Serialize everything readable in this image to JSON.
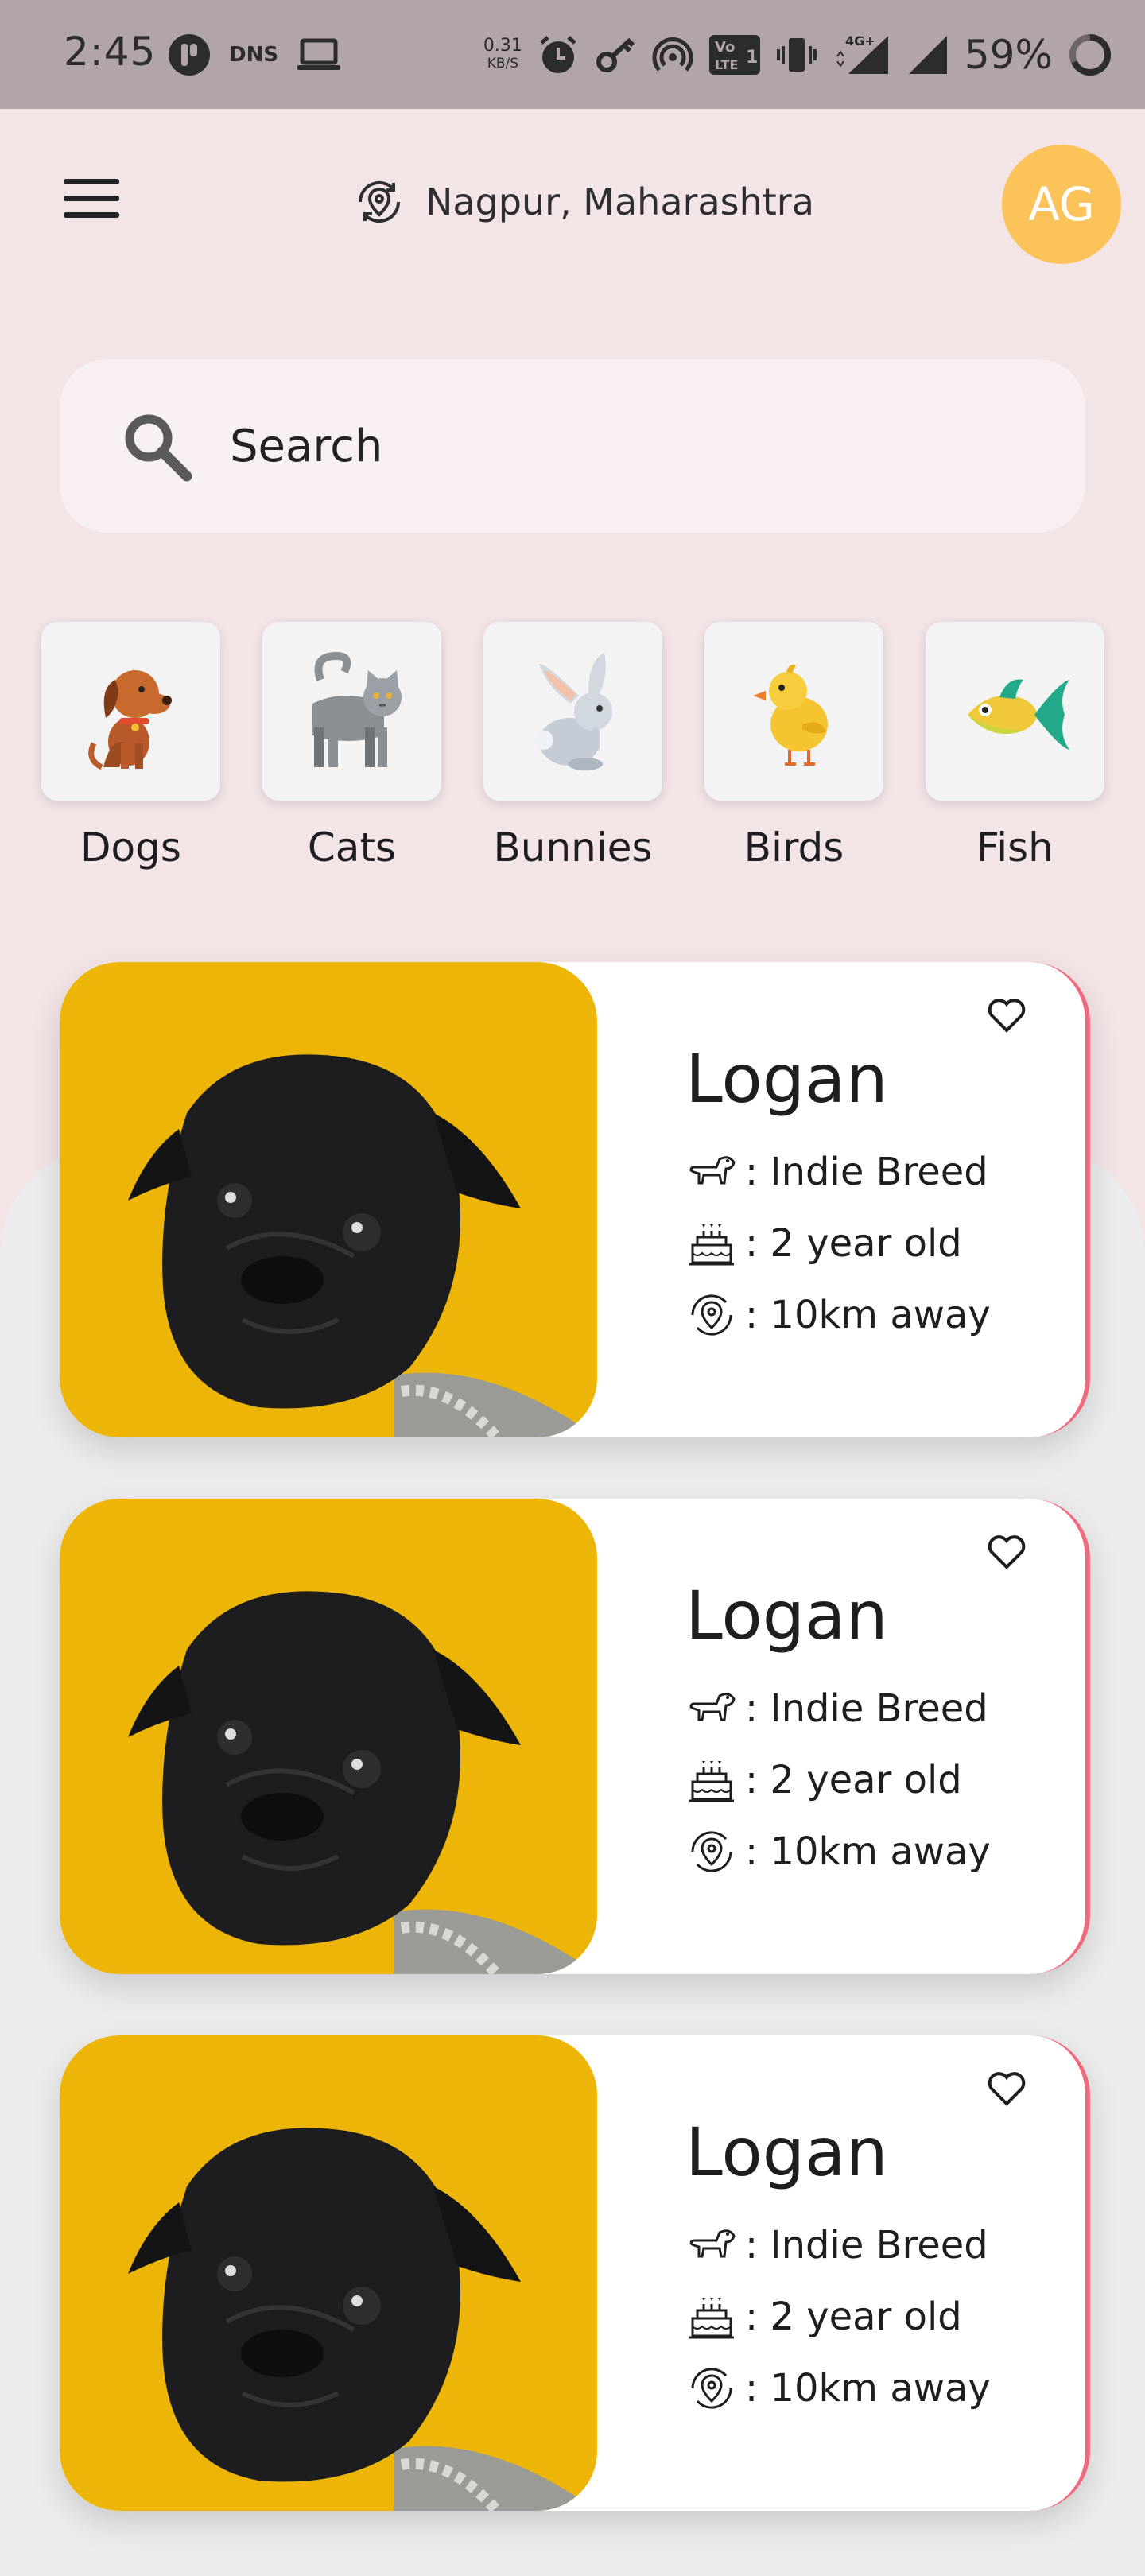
{
  "status_bar": {
    "time": "2:45",
    "dns_label": "DNS",
    "speed_value": "0.31",
    "speed_unit": "KB/S",
    "volte_label": "Vo LTE 1",
    "network_label": "4G+",
    "battery": "59%"
  },
  "header": {
    "location": "Nagpur, Maharashtra",
    "avatar_initials": "AG"
  },
  "search": {
    "placeholder": "Search"
  },
  "categories": [
    {
      "label": "Dogs",
      "icon": "dog-icon"
    },
    {
      "label": "Cats",
      "icon": "cat-icon"
    },
    {
      "label": "Bunnies",
      "icon": "bunny-icon"
    },
    {
      "label": "Birds",
      "icon": "bird-icon"
    },
    {
      "label": "Fish",
      "icon": "fish-icon"
    }
  ],
  "pets": [
    {
      "name": "Logan",
      "breed": ": Indie Breed",
      "age": ": 2 year old",
      "distance": ": 10km away"
    },
    {
      "name": "Logan",
      "breed": ": Indie Breed",
      "age": ": 2 year old",
      "distance": ": 10km away"
    },
    {
      "name": "Logan",
      "breed": ": Indie Breed",
      "age": ": 2 year old",
      "distance": ": 10km away"
    }
  ],
  "colors": {
    "app_background": "#f3e4e6",
    "avatar": "#fbc35a",
    "card_image_bg": "#ecb507",
    "card_accent": "#ee6b7d"
  }
}
